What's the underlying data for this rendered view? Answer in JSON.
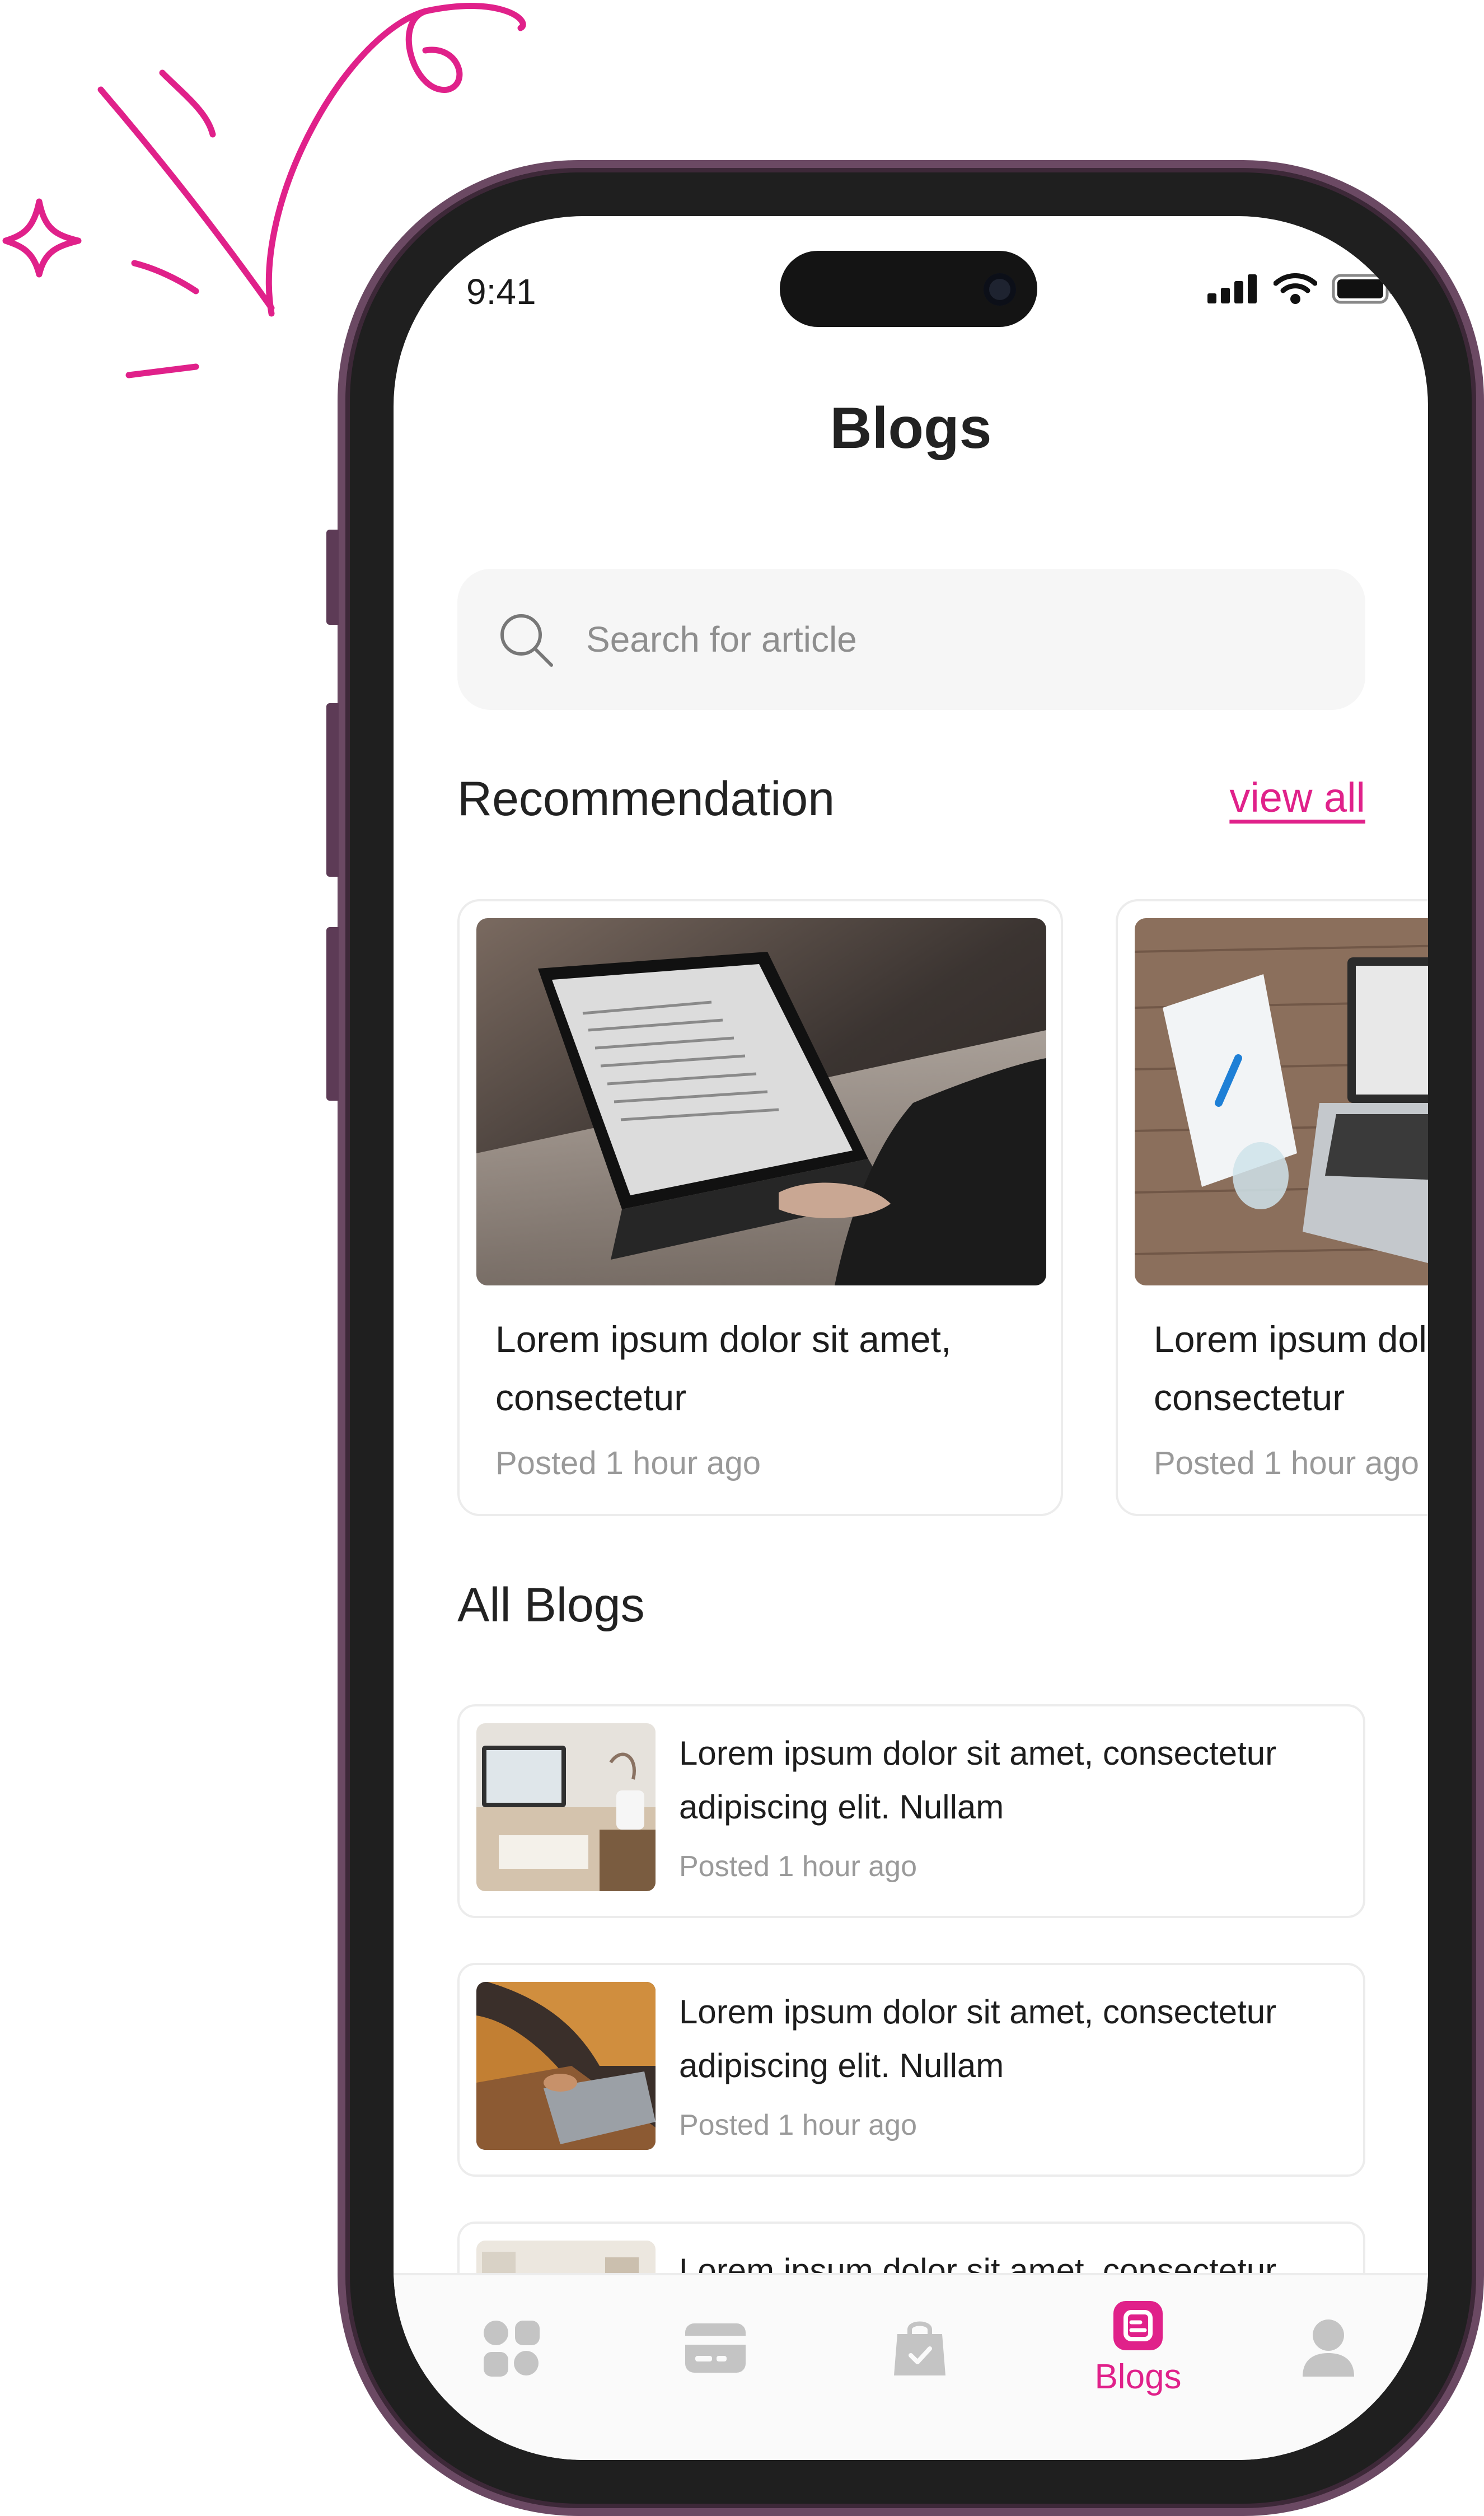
{
  "status_bar": {
    "time": "9:41"
  },
  "header": {
    "title": "Blogs"
  },
  "search": {
    "placeholder": "Search for article",
    "value": ""
  },
  "recommendation": {
    "title": "Recommendation",
    "view_all": "view all",
    "cards": [
      {
        "title": "Lorem ipsum dolor sit amet, consectetur",
        "time": "Posted 1 hour ago"
      },
      {
        "title": "Lorem ipsum dolor sit amet, consectetur",
        "time": "Posted 1 hour ago"
      }
    ]
  },
  "all_blogs": {
    "title": "All Blogs",
    "items": [
      {
        "title": "Lorem ipsum dolor sit amet, consectetur adipiscing elit. Nullam",
        "time": "Posted 1 hour ago"
      },
      {
        "title": "Lorem ipsum dolor sit amet, consectetur adipiscing elit. Nullam",
        "time": "Posted 1 hour ago"
      },
      {
        "title": "Lorem ipsum dolor sit amet, consectetur",
        "time": ""
      }
    ]
  },
  "bottom_nav": {
    "active": "Blogs",
    "items": [
      {
        "icon": "grid-icon"
      },
      {
        "icon": "card-icon"
      },
      {
        "icon": "shopping-bag-icon"
      },
      {
        "icon": "blog-icon",
        "label": "Blogs"
      },
      {
        "icon": "profile-icon"
      }
    ]
  },
  "colors": {
    "accent": "#e0218a",
    "frame": "#6b4963",
    "text": "#222222",
    "muted": "#999999"
  }
}
